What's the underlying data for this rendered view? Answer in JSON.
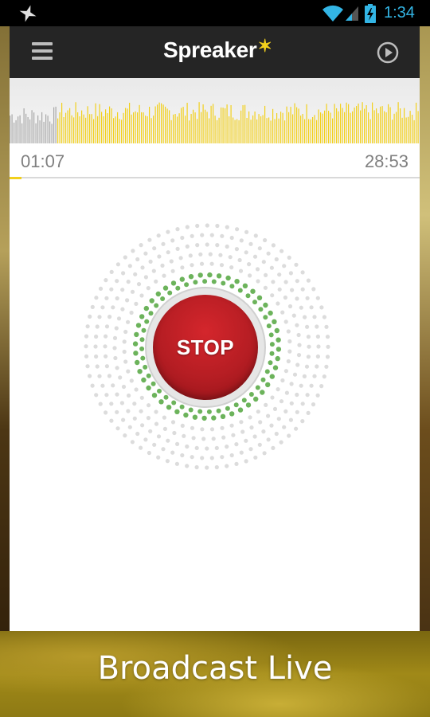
{
  "status_bar": {
    "time": "1:34",
    "icons": [
      "notification-star-icon",
      "wifi-icon",
      "signal-icon",
      "battery-charging-icon"
    ],
    "accent": "#33b5e5"
  },
  "toolbar": {
    "logo_text": "Spreaker",
    "logo_star": "✶",
    "menu_icon": "hamburger-menu-icon",
    "play_icon": "play-circle-icon",
    "background": "#252525"
  },
  "player": {
    "elapsed": "01:07",
    "remaining": "28:53",
    "progress_fraction": 0.03,
    "waveform_played_fraction": 0.12,
    "accent": "#f2d01c"
  },
  "record": {
    "stop_label": "STOP",
    "button_color": "#b51d23",
    "active_ring_color": "#6cb35b"
  },
  "banner": {
    "text": "Broadcast Live"
  }
}
